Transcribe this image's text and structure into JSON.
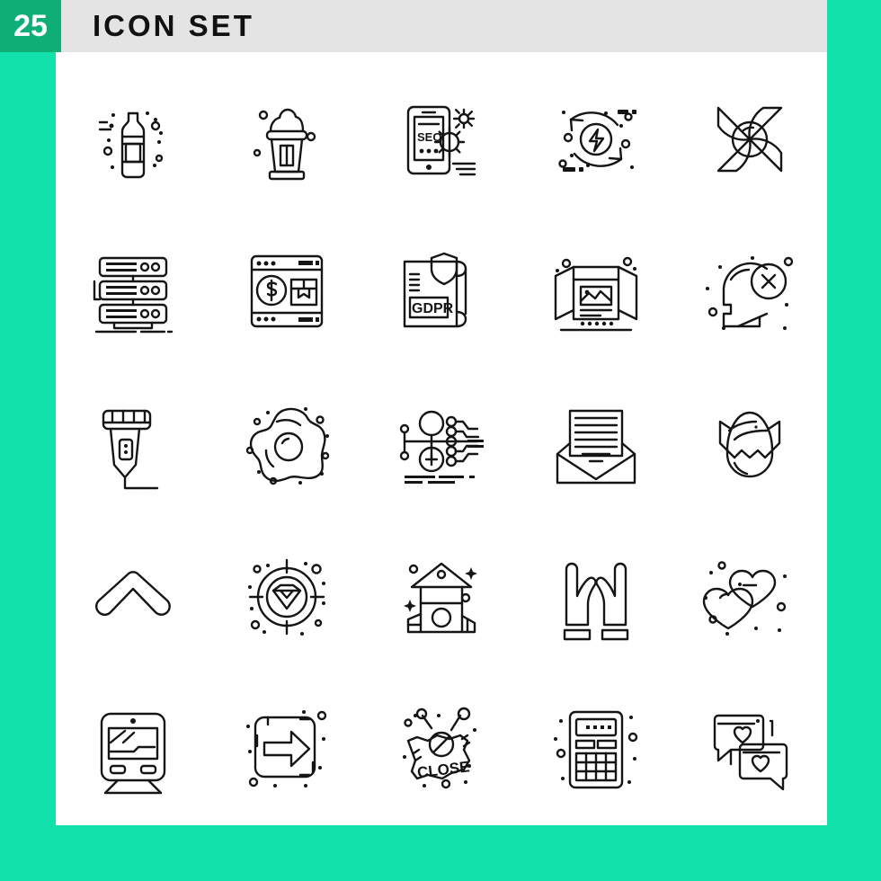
{
  "header": {
    "count_badge": "25",
    "title": "ICON SET",
    "badge_color": "#0FAE77",
    "title_bar_color": "#E4E4E4",
    "background_color": "#12E1AC",
    "sheet_color": "#FFFFFF",
    "stroke_color": "#151515"
  },
  "grid": {
    "columns": 5,
    "rows": 5,
    "total": 25
  },
  "icons": [
    {
      "index": 1,
      "name": "bottle-icon",
      "label": "Bottle"
    },
    {
      "index": 2,
      "name": "ice-cream-cup-icon",
      "label": "Ice Cream"
    },
    {
      "index": 3,
      "name": "mobile-seo-settings-icon",
      "label": "Mobile SEO",
      "text": "SEO"
    },
    {
      "index": 4,
      "name": "renewable-energy-icon",
      "label": "Renewable Energy"
    },
    {
      "index": 5,
      "name": "flower-icon",
      "label": "Flower"
    },
    {
      "index": 6,
      "name": "server-rack-icon",
      "label": "Server"
    },
    {
      "index": 7,
      "name": "online-shopping-icon",
      "label": "Online Shopping"
    },
    {
      "index": 8,
      "name": "gdpr-document-icon",
      "label": "GDPR",
      "text": "GDPR"
    },
    {
      "index": 9,
      "name": "exhibition-booth-icon",
      "label": "Exhibition Booth"
    },
    {
      "index": 10,
      "name": "head-reject-icon",
      "label": "Negative Thinking"
    },
    {
      "index": 11,
      "name": "electric-shaver-icon",
      "label": "Shaver"
    },
    {
      "index": 12,
      "name": "fried-egg-icon",
      "label": "Fried Egg"
    },
    {
      "index": 13,
      "name": "network-distribution-icon",
      "label": "Network"
    },
    {
      "index": 14,
      "name": "open-envelope-icon",
      "label": "Envelope"
    },
    {
      "index": 15,
      "name": "cracked-easter-egg-icon",
      "label": "Easter Egg"
    },
    {
      "index": 16,
      "name": "chevron-up-icon",
      "label": "Chevron Up"
    },
    {
      "index": 17,
      "name": "diamond-target-icon",
      "label": "Target"
    },
    {
      "index": 18,
      "name": "playhouse-icon",
      "label": "Playhouse"
    },
    {
      "index": 19,
      "name": "caring-hands-icon",
      "label": "Caring Hands"
    },
    {
      "index": 20,
      "name": "two-hearts-icon",
      "label": "Hearts"
    },
    {
      "index": 21,
      "name": "train-icon",
      "label": "Train"
    },
    {
      "index": 22,
      "name": "arrow-right-box-icon",
      "label": "Exit Arrow"
    },
    {
      "index": 23,
      "name": "close-sign-icon",
      "label": "Close Sign",
      "text": "CLOSE"
    },
    {
      "index": 24,
      "name": "calculator-icon",
      "label": "Calculator"
    },
    {
      "index": 25,
      "name": "heart-chat-bubbles-icon",
      "label": "Love Chat"
    }
  ]
}
